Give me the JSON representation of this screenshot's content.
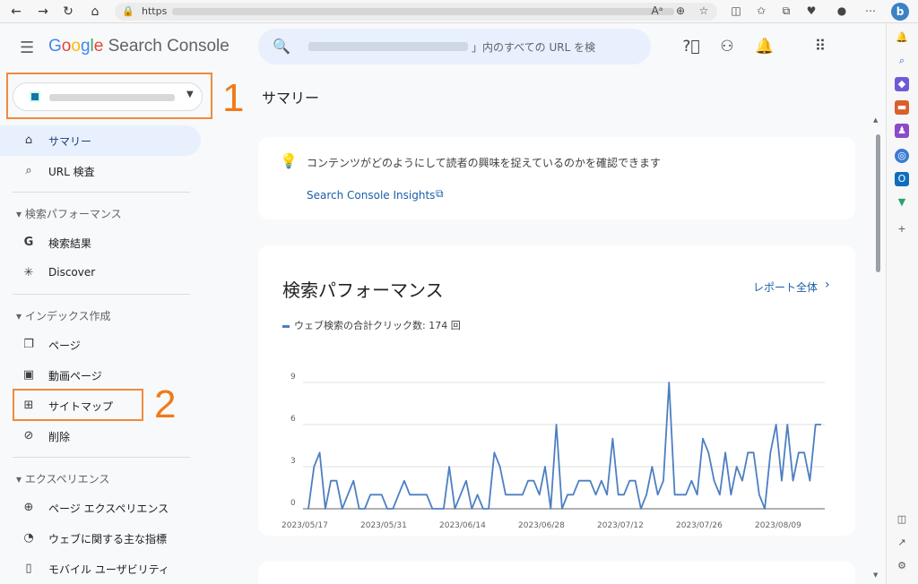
{
  "browser": {
    "url_prefix": "https",
    "icons": [
      "back-arrow-icon",
      "forward-arrow-icon",
      "refresh-icon",
      "home-icon"
    ],
    "bing_label": "b"
  },
  "header": {
    "logo_google": [
      "G",
      "o",
      "o",
      "g",
      "l",
      "e"
    ],
    "logo_product": "Search Console",
    "search_placeholder": "」内のすべての URL を検"
  },
  "property": {
    "name_hidden": true
  },
  "annotations": {
    "one": "1",
    "two": "2"
  },
  "nav": {
    "summary": "サマリー",
    "url_inspection": "URL 検査",
    "section_performance": "検索パフォーマンス",
    "search_results": "検索結果",
    "discover": "Discover",
    "section_index": "インデックス作成",
    "pages": "ページ",
    "video_pages": "動画ページ",
    "sitemaps": "サイトマップ",
    "removals": "削除",
    "section_experience": "エクスペリエンス",
    "page_experience": "ページ エクスペリエンス",
    "core_web_vitals": "ウェブに関する主な指標",
    "mobile_usability": "モバイル ユーザビリティ"
  },
  "main": {
    "title": "サマリー",
    "insight_text": "コンテンツがどのようにして読者の興味を捉えているのかを確認できます",
    "insight_link": "Search Console Insights",
    "perf_title": "検索パフォーマンス",
    "report_link": "レポート全体"
  },
  "colors": {
    "accent": "#1a73e8",
    "line": "#4d7fc2",
    "annotation": "#f07a1a"
  },
  "chart_data": {
    "type": "line",
    "title": "",
    "legend": "ウェブ検索の合計クリック数: 174 回",
    "ylim": [
      0,
      9
    ],
    "yticks": [
      0,
      3,
      6,
      9
    ],
    "xtick_labels": [
      "2023/05/17",
      "2023/05/31",
      "2023/06/14",
      "2023/06/28",
      "2023/07/12",
      "2023/07/26",
      "2023/08/09"
    ],
    "values": [
      0,
      3,
      4,
      0,
      2,
      2,
      0,
      1,
      2,
      0,
      0,
      1,
      1,
      1,
      0,
      0,
      1,
      2,
      1,
      1,
      1,
      1,
      0,
      0,
      0,
      3,
      0,
      1,
      2,
      0,
      1,
      0,
      0,
      4,
      3,
      1,
      1,
      1,
      1,
      2,
      2,
      1,
      3,
      0,
      6,
      0,
      1,
      1,
      2,
      2,
      2,
      1,
      2,
      1,
      5,
      1,
      1,
      2,
      2,
      0,
      1,
      3,
      1,
      2,
      9,
      1,
      1,
      1,
      2,
      1,
      5,
      4,
      2,
      1,
      4,
      1,
      3,
      2,
      4,
      4,
      1,
      0,
      4,
      6,
      2,
      6,
      2,
      4,
      4,
      2,
      6,
      6
    ]
  }
}
